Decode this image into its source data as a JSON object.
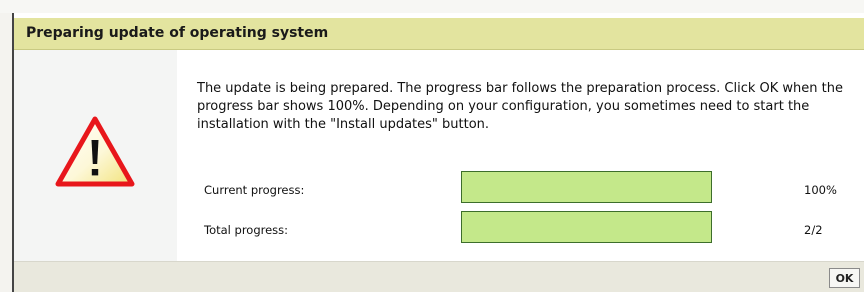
{
  "dialog": {
    "title": "Preparing update of operating system",
    "icon": "warning-icon",
    "message": "The update is being prepared. The progress bar follows the preparation process. Click OK when the progress bar shows 100%. Depending on your configuration, you sometimes need to start the installation with the \"Install updates\" button."
  },
  "progress": {
    "current": {
      "label": "Current progress:",
      "value_text": "100%",
      "fraction": 1.0
    },
    "total": {
      "label": "Total progress:",
      "value_text": "2/2",
      "fraction": 1.0
    }
  },
  "buttons": {
    "ok_label": "OK"
  },
  "colors": {
    "titlebar": "#e3e49f",
    "progress_fill": "#c4e88a",
    "progress_border": "#3d6e2b",
    "warning_red": "#e8171b",
    "warning_yellow": "#f6eb9a",
    "footer": "#e9e8dd"
  }
}
